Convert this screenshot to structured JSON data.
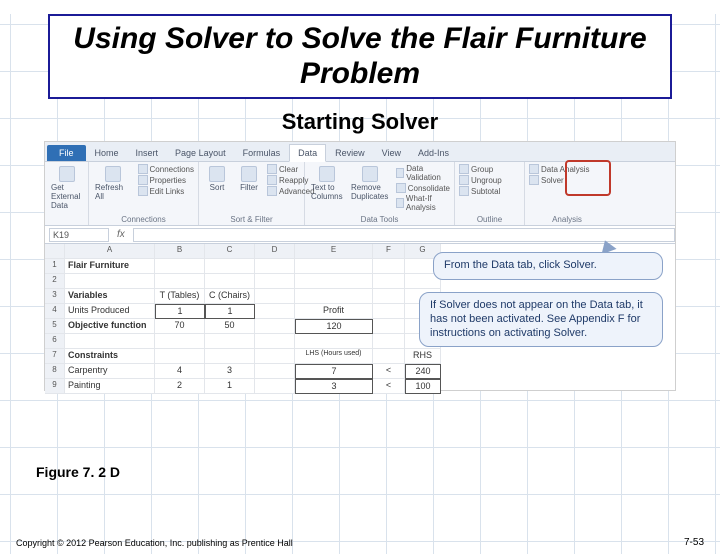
{
  "title": "Using Solver to Solve the Flair Furniture Problem",
  "subtitle": "Starting Solver",
  "ribbon": {
    "file": "File",
    "tabs": [
      "Home",
      "Insert",
      "Page Layout",
      "Formulas",
      "Data",
      "Review",
      "View",
      "Add-Ins"
    ],
    "active_tab": "Data",
    "groups": {
      "g1_label": "",
      "g1_btn": "Get External Data",
      "g2_btn": "Refresh All",
      "g2_lines": [
        "Connections",
        "Properties",
        "Edit Links"
      ],
      "g2_label": "Connections",
      "g3_a": "Sort",
      "g3_b": "Filter",
      "g3_lines": [
        "Clear",
        "Reapply",
        "Advanced"
      ],
      "g3_label": "Sort & Filter",
      "g4_a": "Text to Columns",
      "g4_b": "Remove Duplicates",
      "g4_lines": [
        "Data Validation",
        "Consolidate",
        "What-If Analysis"
      ],
      "g4_label": "Data Tools",
      "g5_lines": [
        "Group",
        "Ungroup",
        "Subtotal"
      ],
      "g5_label": "Outline",
      "g6_a": "Data Analysis",
      "g6_b": "Solver",
      "g6_label": "Analysis"
    }
  },
  "namebox": "K19",
  "sheet": {
    "cols": [
      "",
      "A",
      "B",
      "C",
      "D",
      "E",
      "F",
      "G"
    ],
    "rows": [
      {
        "n": "1",
        "A": "Flair Furniture",
        "bold": true
      },
      {
        "n": "2"
      },
      {
        "n": "3",
        "A": "Variables",
        "B": "T (Tables)",
        "C": "C (Chairs)",
        "bold": true
      },
      {
        "n": "4",
        "A": "Units Produced",
        "B": "1",
        "C": "1",
        "E": "Profit"
      },
      {
        "n": "5",
        "A": "Objective function",
        "B": "70",
        "C": "50",
        "E": "120",
        "bold": true
      },
      {
        "n": "6"
      },
      {
        "n": "7",
        "A": "Constraints",
        "E": "LHS (Hours used)",
        "G": "RHS",
        "bold": true
      },
      {
        "n": "8",
        "A": "Carpentry",
        "B": "4",
        "C": "3",
        "E": "7",
        "F": "<",
        "G": "240"
      },
      {
        "n": "9",
        "A": "Painting",
        "B": "2",
        "C": "1",
        "E": "3",
        "F": "<",
        "G": "100"
      }
    ]
  },
  "callout1": "From the Data tab, click Solver.",
  "callout2": "If Solver does not appear on the Data tab, it has not been activated. See Appendix F for instructions on activating Solver.",
  "figure_label": "Figure 7. 2 D",
  "copyright": "Copyright © 2012 Pearson Education, Inc. publishing as Prentice Hall",
  "page": "7-53"
}
